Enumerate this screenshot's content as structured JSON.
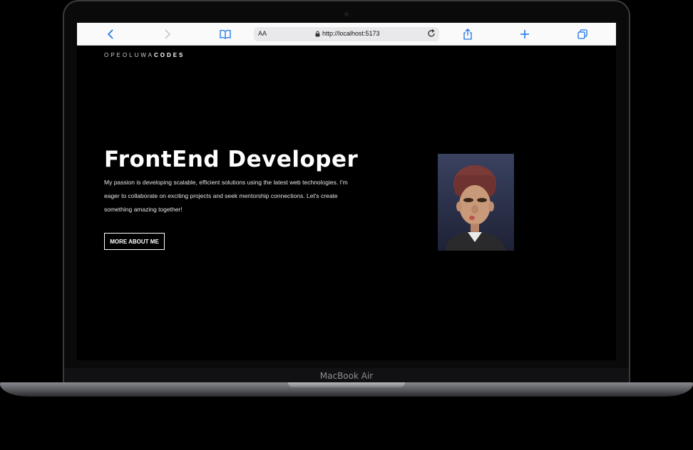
{
  "device": {
    "label": "MacBook Air"
  },
  "browser": {
    "url": "http://localhost:5173",
    "text_size_label": "AA",
    "icons": [
      "back-icon",
      "forward-icon",
      "bookmarks-icon",
      "lock-icon",
      "reload-icon",
      "share-icon",
      "new-tab-icon",
      "tabs-icon"
    ],
    "accent": "#1a73e8"
  },
  "site": {
    "brand_light": "OPEOLUWA",
    "brand_bold": "CODES",
    "hero": {
      "title": "FrontEnd Developer",
      "description": "My passion is developing scalable, efficient solutions using the latest web technologies. I'm eager to collaborate on exciting projects and seek mentorship connections. Let's create something amazing together!",
      "button_label": "MORE ABOUT ME"
    },
    "colors": {
      "background": "#000000",
      "text": "#ffffff"
    }
  }
}
